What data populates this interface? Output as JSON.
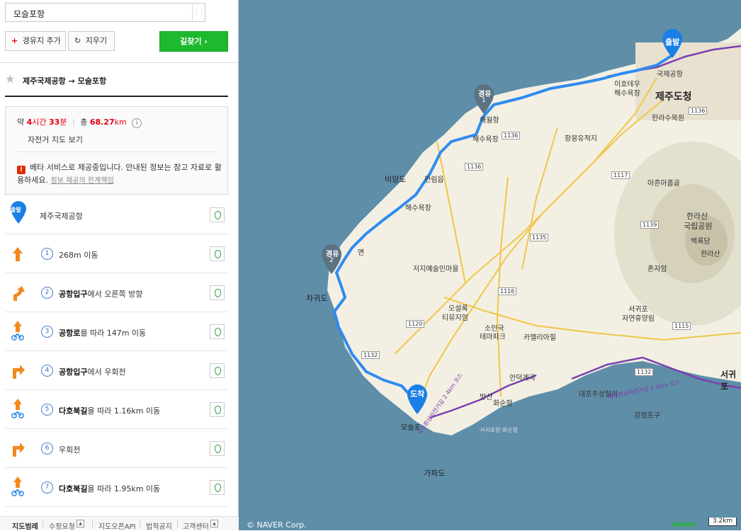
{
  "search": {
    "value": "모슬포항"
  },
  "toolbar": {
    "add_waypoint_label": "경유지 추가",
    "clear_label": "지우기",
    "find_route_label": "길찾기 ›"
  },
  "route": {
    "title": "제주국제공항 → 모슬포항"
  },
  "summary": {
    "approx": "약",
    "hours": "4",
    "hours_unit": "시간",
    "minutes": "33",
    "minutes_unit": "분",
    "total": "총",
    "distance": "68.27",
    "distance_unit": "km",
    "bike_map_link": "자전거 지도 보기",
    "warning_text": "베타 서비스로 제공중입니다. 안내된 정보는 참고 자료로 활용하세요.",
    "warning_link": "정보 제공의 한계책임"
  },
  "steps": [
    {
      "badge": "출발",
      "text": "제주국제공항"
    },
    {
      "num": "1",
      "bold": "",
      "text": "268m 이동"
    },
    {
      "num": "2",
      "bold": "공항입구",
      "text": "에서 오른쪽 방향"
    },
    {
      "num": "3",
      "bold": "공항로",
      "text": "를 따라 147m 이동"
    },
    {
      "num": "4",
      "bold": "공항입구",
      "text": "에서 우회전"
    },
    {
      "num": "5",
      "bold": "다호북길",
      "text": "을 따라 1.16km 이동"
    },
    {
      "num": "6",
      "bold": "",
      "text": "우회전"
    },
    {
      "num": "7",
      "bold": "다호북길",
      "text": "을 따라 1.95km 이동"
    }
  ],
  "footer": {
    "items": [
      "지도범례",
      "수정요청",
      "지도오픈API",
      "법적공지",
      "고객센터"
    ]
  },
  "map": {
    "copyright": "© NAVER Corp.",
    "logo": "NAVER",
    "scale": "3.2km",
    "markers": {
      "start": "출발",
      "waypoint": "경유",
      "wp1_num": "1",
      "wp2_num": "2",
      "end": "도착"
    },
    "labels": [
      "국제공항",
      "이호테우",
      "해수욕장",
      "제주도청",
      "한라수목원",
      "협재",
      "해월항",
      "해수욕장",
      "항몽유적지",
      "비양도",
      "한림읍",
      "아흔아홉골",
      "해수욕장",
      "한라산",
      "국립공원",
      "백록담",
      "한라산",
      "존자암",
      "면",
      "저지예술인마을",
      "차귀도",
      "오설록",
      "티뮤지엄",
      "서귀포",
      "자연휴양림",
      "소인국",
      "테마파크",
      "카멜리아힐",
      "안덕계곡",
      "서귀포",
      "대포주상절리",
      "방산",
      "화순항",
      "강정포구",
      "모슬포",
      "가파도",
      "서귀포항·화순항",
      "제주환상자전거길 2.4km 코스",
      "제주환상자전거길 2.4km 코스"
    ],
    "road_numbers": [
      "1136",
      "1136",
      "1136",
      "1117",
      "1139",
      "1135",
      "1116",
      "1120",
      "1132",
      "1115",
      "1132"
    ],
    "colors": {
      "sea": "#5f8ea8",
      "land": "#f4f1e6",
      "route": "#2f8bf0",
      "bike_path": "#7a3fb0",
      "marker_blue": "#1a7fe6",
      "marker_gray": "#5d7384"
    }
  }
}
